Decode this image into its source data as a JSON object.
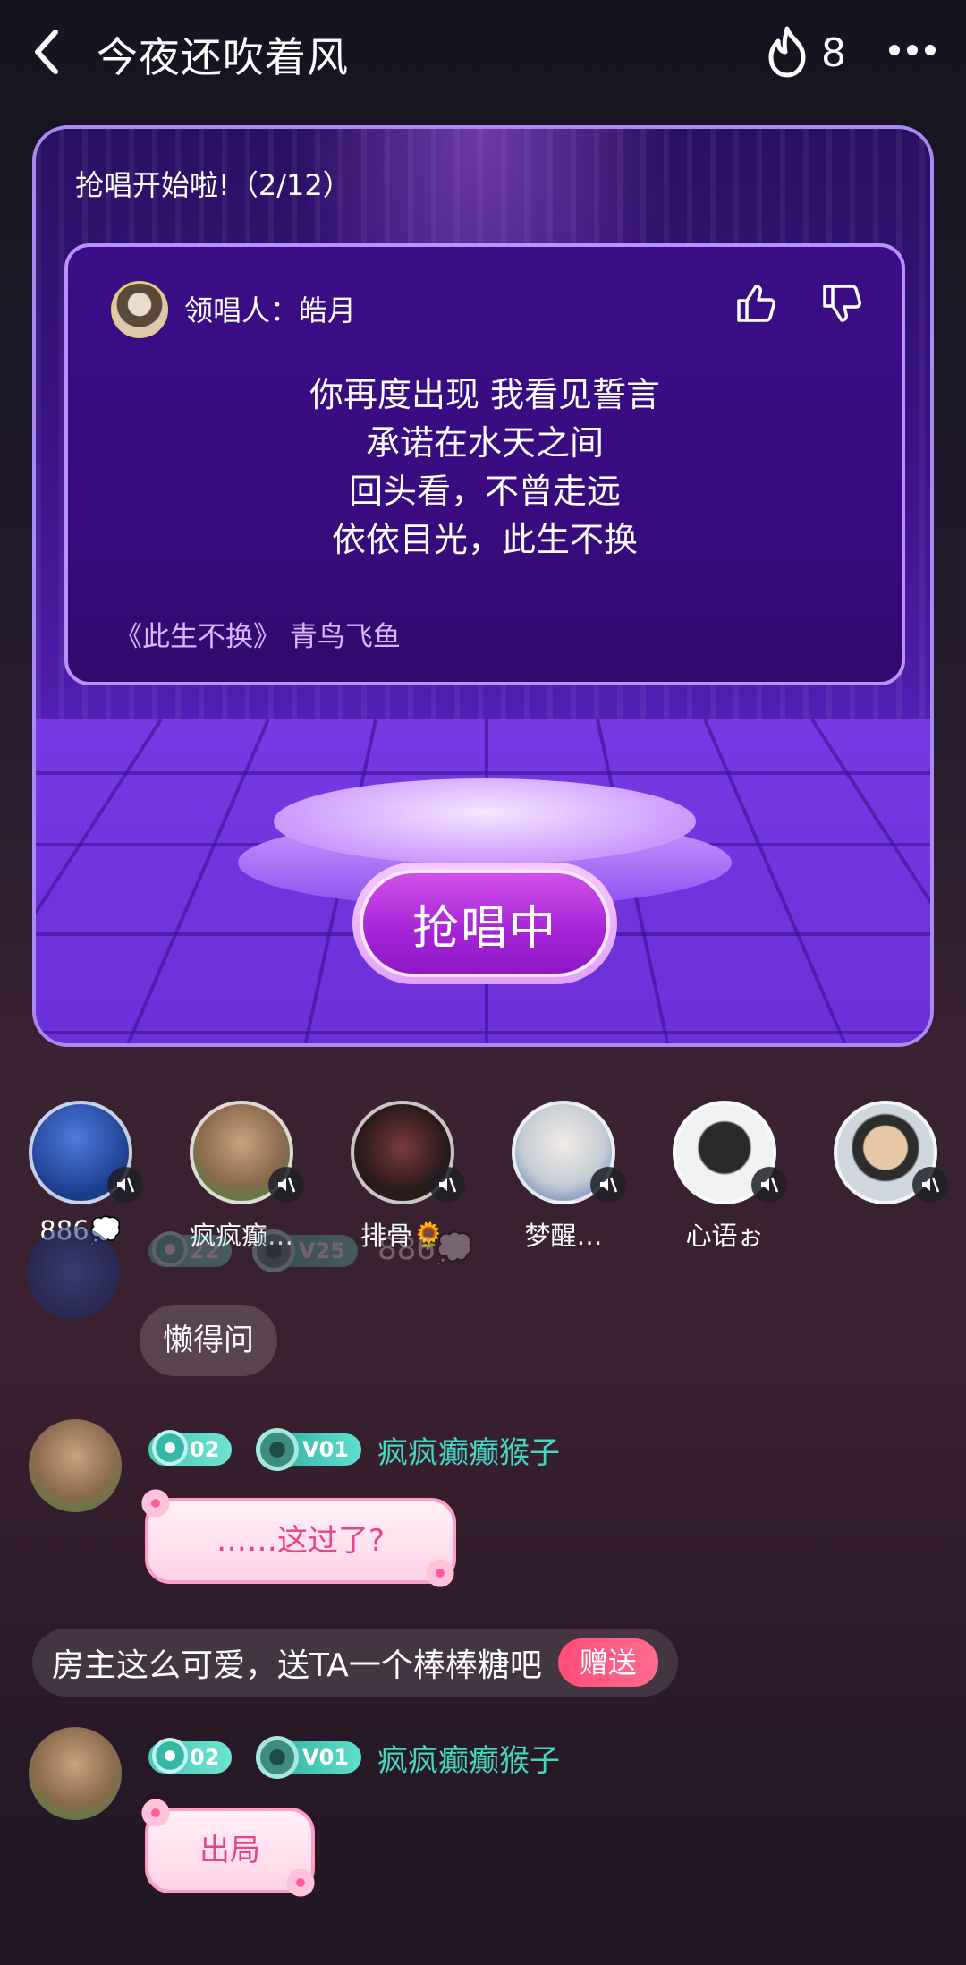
{
  "header": {
    "title": "今夜还吹着风",
    "hot_count": "8"
  },
  "game": {
    "header": "抢唱开始啦!（2/12）",
    "leader_label": "领唱人：皓月",
    "lyrics": [
      "你再度出现 我看见誓言",
      "承诺在水天之间",
      "回头看，不曾走远",
      "依依目光，此生不换"
    ],
    "song_info": "《此生不换》 青鸟飞鱼",
    "sing_button": "抢唱中"
  },
  "seats": [
    {
      "nick": "886💭",
      "color": "#1b3c8a"
    },
    {
      "nick": "疯疯癫…",
      "color": "#8a6b4f"
    },
    {
      "nick": "排骨🌻",
      "color": "#2a1a1a"
    },
    {
      "nick": "梦醒…",
      "color": "#c5ccd6"
    },
    {
      "nick": "心语ぉ",
      "color": "#f1f1f1"
    },
    {
      "nick": "",
      "color": "#cfd6de"
    }
  ],
  "chat": {
    "faded_header": {
      "level": "22",
      "vip": "V25",
      "name": "886💭"
    },
    "messages": [
      {
        "text": "懒得问"
      },
      {
        "level": "02",
        "vip": "V01",
        "name": "疯疯癫癫猴子",
        "text": "……这过了?"
      },
      {
        "level": "02",
        "vip": "V01",
        "name": "疯疯癫癫猴子",
        "text": "出局"
      }
    ],
    "system_tip": {
      "text": "房主这么可爱，送TA一个棒棒糖吧",
      "button": "赠送"
    }
  },
  "colors": {
    "accent_teal": "#46d7c2",
    "pink_button": "#ff4d7a",
    "purple_card": "#4b1aa0"
  }
}
